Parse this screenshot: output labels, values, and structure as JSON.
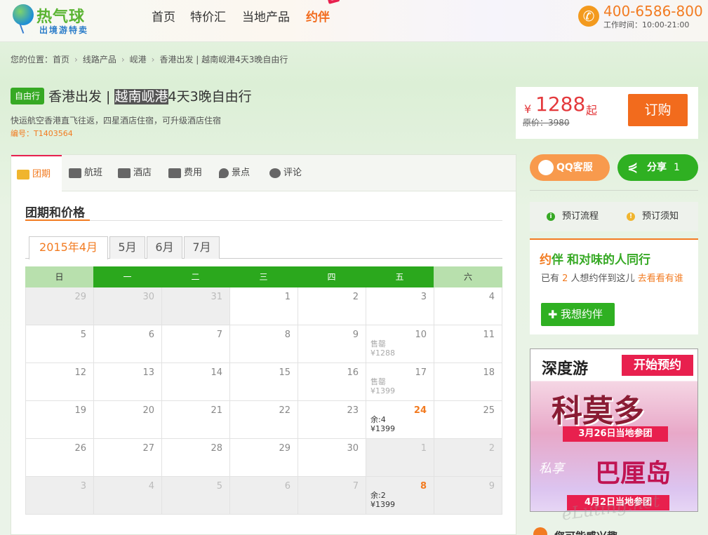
{
  "header": {
    "logo_name": "热气球",
    "logo_sub": "出境游特卖",
    "nav": [
      "首页",
      "特价汇",
      "当地产品",
      "约伴"
    ],
    "new_badge": "新",
    "phone": "400-6586-800",
    "hours": "工作时间：10:00-21:00"
  },
  "breadcrumb": [
    "您的位置：首页",
    "线路产品",
    "岘港",
    "香港出发 | 越南岘港4天3晚自由行"
  ],
  "product": {
    "tag": "自由行",
    "title_pre": "香港出发 | ",
    "title_hl": "越南岘港",
    "title_post": "4天3晚自由行",
    "subtitle": "快运航空香港直飞往返，四星酒店住宿，可升级酒店住宿",
    "code": "编号：T1403564"
  },
  "price": {
    "currency": "¥",
    "value": "1288",
    "suffix": "起",
    "original": "原价：3980",
    "buy_label": "订购"
  },
  "tabs": [
    "团期",
    "航班",
    "酒店",
    "费用",
    "景点",
    "评论"
  ],
  "section_title": "团期和价格",
  "months": [
    "2015年4月",
    "5月",
    "6月",
    "7月"
  ],
  "weekdays": [
    "日",
    "一",
    "二",
    "三",
    "四",
    "五",
    "六"
  ],
  "calendar": [
    [
      {
        "d": "29",
        "o": true
      },
      {
        "d": "30",
        "o": true
      },
      {
        "d": "31",
        "o": true
      },
      {
        "d": "1"
      },
      {
        "d": "2"
      },
      {
        "d": "3"
      },
      {
        "d": "4"
      }
    ],
    [
      {
        "d": "5"
      },
      {
        "d": "6"
      },
      {
        "d": "7"
      },
      {
        "d": "8"
      },
      {
        "d": "9"
      },
      {
        "d": "10",
        "s": "售罄",
        "p": "¥1288"
      },
      {
        "d": "11"
      }
    ],
    [
      {
        "d": "12"
      },
      {
        "d": "13"
      },
      {
        "d": "14"
      },
      {
        "d": "15"
      },
      {
        "d": "16"
      },
      {
        "d": "17",
        "s": "售罄",
        "p": "¥1399"
      },
      {
        "d": "18"
      }
    ],
    [
      {
        "d": "19"
      },
      {
        "d": "20"
      },
      {
        "d": "21"
      },
      {
        "d": "22"
      },
      {
        "d": "23"
      },
      {
        "d": "24",
        "s": "余:4",
        "p": "¥1399",
        "h": true
      },
      {
        "d": "25"
      }
    ],
    [
      {
        "d": "26"
      },
      {
        "d": "27"
      },
      {
        "d": "28"
      },
      {
        "d": "29"
      },
      {
        "d": "30"
      },
      {
        "d": "1",
        "o": true
      },
      {
        "d": "2",
        "o": true
      }
    ],
    [
      {
        "d": "3",
        "o": true
      },
      {
        "d": "4",
        "o": true
      },
      {
        "d": "5",
        "o": true
      },
      {
        "d": "6",
        "o": true
      },
      {
        "d": "7",
        "o": true
      },
      {
        "d": "8",
        "o": true,
        "s": "余:2",
        "p": "¥1399",
        "h": true
      },
      {
        "d": "9",
        "o": true
      }
    ]
  ],
  "side": {
    "qq_label": "QQ客服",
    "share_label": "分享",
    "share_count": "1",
    "process_label": "预订流程",
    "notice_label": "预订须知",
    "yueban_brand_1": "约",
    "yueban_brand_2": "伴",
    "yueban_title": "和对味的人同行",
    "yueban_desc_1": "已有 ",
    "yueban_count": "2",
    "yueban_desc_2": " 人想约伴到这儿 ",
    "yueban_link": "去看看有谁",
    "yueban_btn": "我想约伴"
  },
  "ad": {
    "brand": "深度游",
    "start": "开始预约",
    "big1": "科莫多",
    "line1": "3月26日当地参团",
    "private": "私享",
    "big2": "巴厘岛",
    "line2": "4月2日当地参团"
  },
  "bottom_text": "您可能感兴趣",
  "watermark": "eLuting.net"
}
